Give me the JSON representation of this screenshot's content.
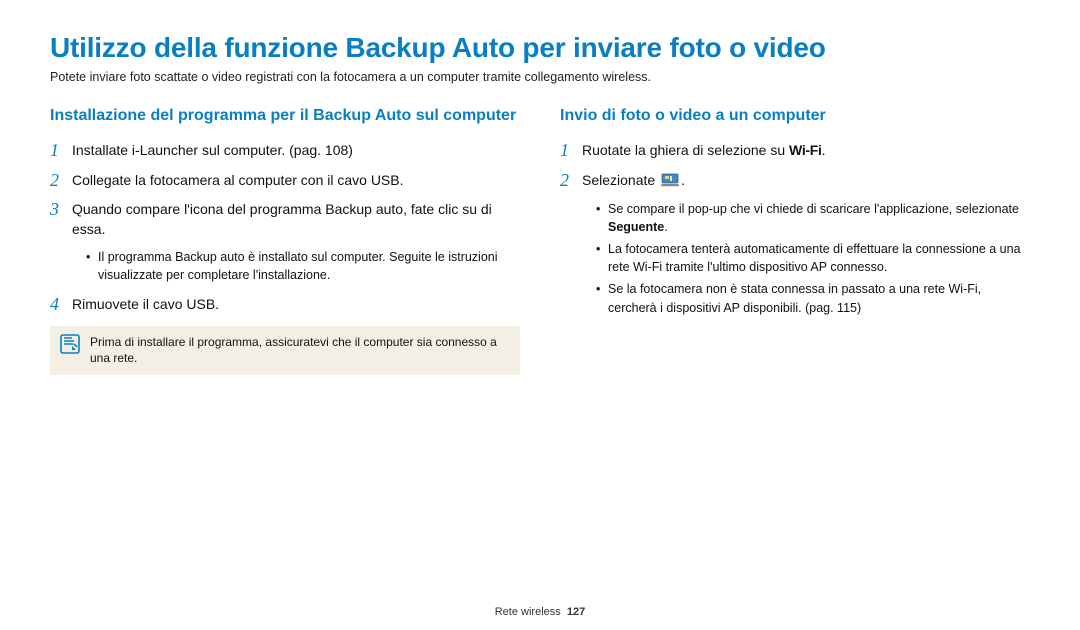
{
  "title": "Utilizzo della funzione Backup Auto per inviare foto o video",
  "subtitle": "Potete inviare foto scattate o video registrati con la fotocamera a un computer tramite collegamento wireless.",
  "left": {
    "heading": "Installazione del programma per il Backup Auto sul computer",
    "steps": {
      "s1": "Installate i-Launcher sul computer. (pag. 108)",
      "s2": "Collegate la fotocamera al computer con il cavo USB.",
      "s3": "Quando compare l'icona del programma Backup auto, fate clic su di essa.",
      "s3_sub": "Il programma Backup auto è installato sul computer. Seguite le istruzioni visualizzate per completare l'installazione.",
      "s4": "Rimuovete il cavo USB."
    },
    "note": "Prima di installare il programma, assicuratevi che il computer sia connesso a una rete."
  },
  "right": {
    "heading": "Invio di foto o video a un computer",
    "steps": {
      "s1_pre": "Ruotate la ghiera di selezione su ",
      "s1_wifi": "Wi-Fi",
      "s1_post": ".",
      "s2_pre": "Selezionate ",
      "s2_post": ".",
      "bullets": {
        "b1_pre": "Se compare il pop-up che vi chiede di scaricare l'applicazione, selezionate ",
        "b1_bold": "Seguente",
        "b1_post": ".",
        "b2": "La fotocamera tenterà automaticamente di effettuare la connessione a una rete Wi-Fi tramite l'ultimo dispositivo AP connesso.",
        "b3": "Se la fotocamera non è stata connessa in passato a una rete Wi-Fi, cercherà i dispositivi AP disponibili. (pag. 115)"
      }
    }
  },
  "footer": {
    "section": "Rete wireless",
    "page": "127"
  }
}
